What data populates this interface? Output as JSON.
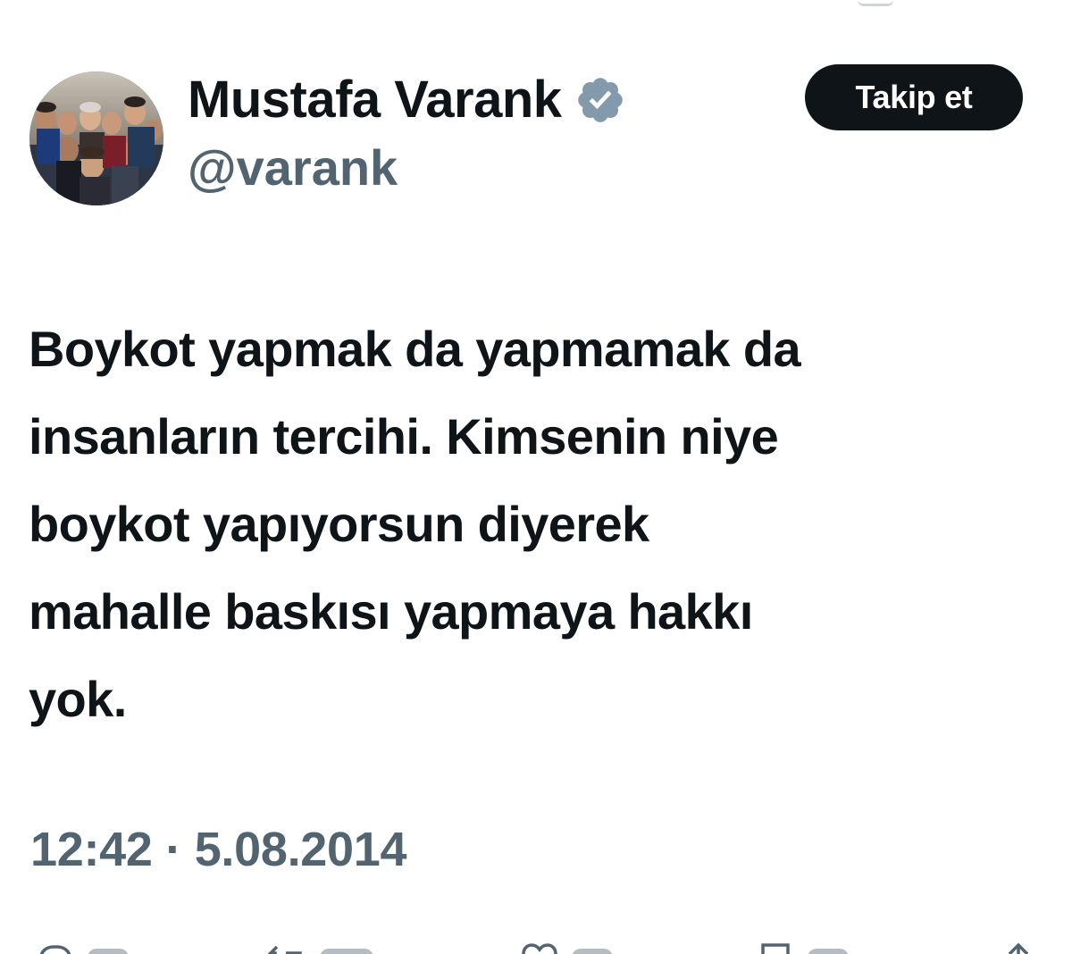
{
  "tweet": {
    "author": {
      "display_name": "Mustafa Varank",
      "handle": "@varank",
      "verified": true
    },
    "follow_label": "Takip et",
    "text_lines": [
      "Boykot yapmak da yapmamak da",
      "insanların tercihi. Kimsenin niye",
      "boykot yapıyorsun diyerek",
      "mahalle baskısı yapmaya hakkı",
      "yok."
    ],
    "timestamp": "12:42 · 5.08.2014"
  },
  "icons": {
    "verified": "verified-badge-icon",
    "reply": "reply-icon",
    "retweet": "retweet-icon",
    "like": "heart-icon",
    "bookmark": "bookmark-icon",
    "share": "share-icon"
  },
  "colors": {
    "text": "#0f1419",
    "secondary": "#536471",
    "verified_badge": "#829aab",
    "button_bg": "#0f1419",
    "button_text": "#ffffff"
  }
}
